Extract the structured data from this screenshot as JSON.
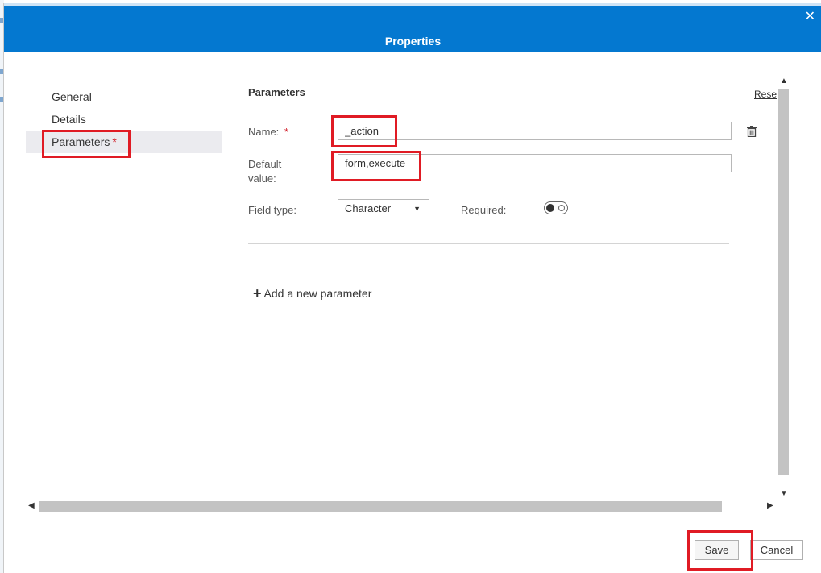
{
  "dialog": {
    "title": "Properties",
    "close_glyph": "✕"
  },
  "nav": {
    "items": [
      {
        "label": "General"
      },
      {
        "label": "Details"
      },
      {
        "label": "Parameters",
        "required_mark": "*"
      }
    ]
  },
  "parameters": {
    "section_title": "Parameters",
    "reset_label": "Reset",
    "name_label": "Name:",
    "name_required_mark": "*",
    "name_value": "_action",
    "default_label_line1": "Default",
    "default_label_line2": "value:",
    "default_value": "form,execute",
    "field_type_label": "Field type:",
    "field_type_value": "Character",
    "required_label": "Required:",
    "required_on": false,
    "add_param_label": "Add a new parameter"
  },
  "footer": {
    "save_label": "Save",
    "cancel_label": "Cancel"
  },
  "colors": {
    "titlebar": "#0478d0",
    "highlight": "#e01b24"
  }
}
